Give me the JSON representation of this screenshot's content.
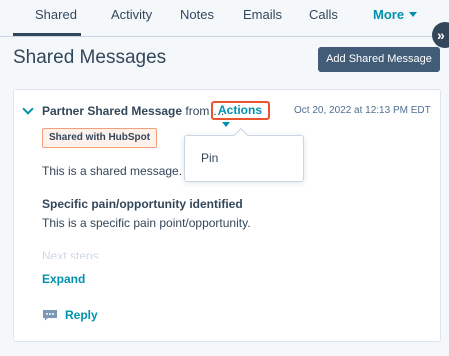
{
  "tabs": {
    "shared": "Shared",
    "activity": "Activity",
    "notes": "Notes",
    "emails": "Emails",
    "calls": "Calls",
    "more": "More"
  },
  "collapse_icon": "»",
  "page": {
    "title": "Shared Messages",
    "add_button": "Add Shared Message"
  },
  "message": {
    "title": "Partner Shared Message",
    "from_text": "from …",
    "actions_label": "Actions",
    "timestamp": "Oct 20, 2022 at 12:13 PM EDT",
    "badge": "Shared with HubSpot",
    "body": "This is a shared message.",
    "section_heading": "Specific pain/opportunity identified",
    "section_text": "This is a specific pain point/opportunity.",
    "faded_text": "Next steps",
    "expand_label": "Expand",
    "reply_label": "Reply"
  },
  "actions_menu": {
    "items": [
      "Pin"
    ]
  },
  "colors": {
    "accent": "#0091ae",
    "highlight_border": "#e8552e",
    "button_bg": "#425b76",
    "text": "#33475b"
  }
}
